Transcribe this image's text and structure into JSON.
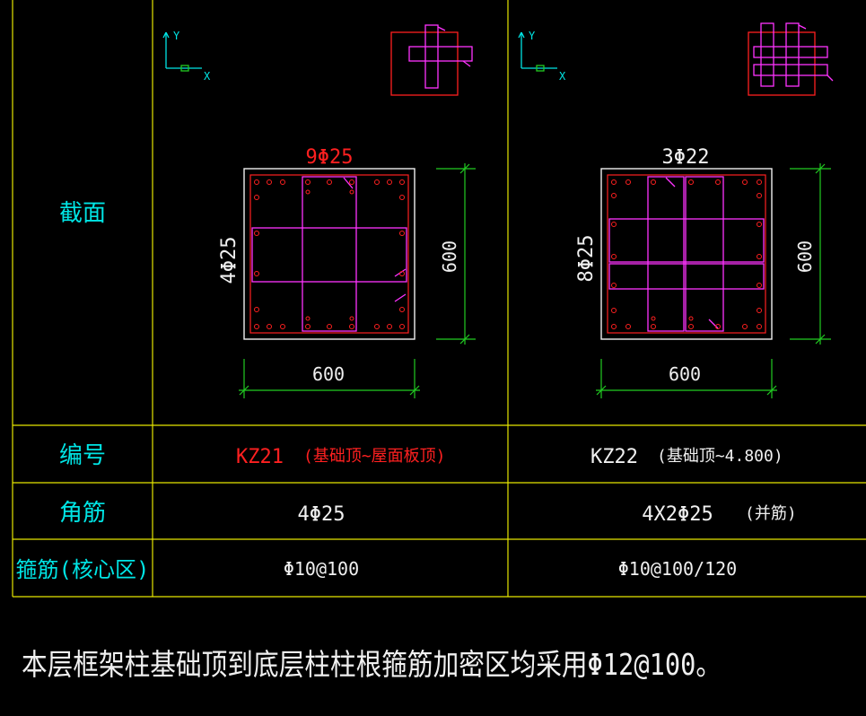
{
  "colors": {
    "grid": "#e6e600",
    "cyan": "#00e5e5",
    "red": "#ff2020",
    "white": "#f0f0f0",
    "magenta": "#ff33ff",
    "green": "#22cc22",
    "background": "#000000"
  },
  "axis": {
    "y": "Y",
    "x": "X"
  },
  "row_labels": {
    "section": "截面",
    "id": "编号",
    "corner": "角筋",
    "stirrup": "箍筋(核心区)"
  },
  "columns": [
    {
      "top_rebar": "9Φ25",
      "side_rebar": "4Φ25",
      "width_dim": "600",
      "height_dim": "600",
      "id": "KZ21",
      "id_range": "(基础顶~屋面板顶)",
      "corner": "4Φ25",
      "corner_note": "",
      "stirrup": "Φ10@100"
    },
    {
      "top_rebar": "3Φ22",
      "side_rebar": "8Φ25",
      "width_dim": "600",
      "height_dim": "600",
      "id": "KZ22",
      "id_range": "(基础顶~4.800)",
      "corner": "4X2Φ25",
      "corner_note": "(并筋)",
      "stirrup": "Φ10@100/120"
    }
  ],
  "note": "本层框架柱基础顶到底层柱柱根箍筋加密区均采用Φ12@100。"
}
